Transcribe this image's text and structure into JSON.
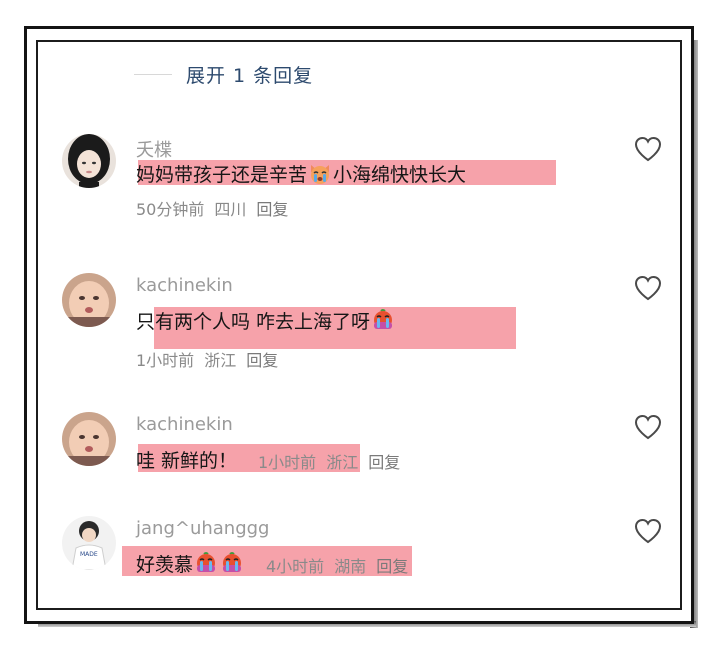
{
  "expand_replies_label": "展开 1 条回复",
  "comments": [
    {
      "username": "夭楪",
      "text_before": "妈妈带孩子还是辛苦",
      "emoji": "crying-cat-emoji",
      "text_after": "小海绵快快长大",
      "time": "50分钟前",
      "location": "四川",
      "reply_label": "回复"
    },
    {
      "username": "kachinekin",
      "text_before": "只有两个人吗 咋去上海了呀",
      "emoji": "crying-face-emoji",
      "text_after": "",
      "time": "1小时前",
      "location": "浙江",
      "reply_label": "回复"
    },
    {
      "username": "kachinekin",
      "text_before": "哇 新鲜的！",
      "emoji": "",
      "text_after": "",
      "time": "1小时前",
      "location": "浙江",
      "reply_label": "回复"
    },
    {
      "username": "jang^uhanggg",
      "text_before": "好羡慕",
      "emoji": "crying-face-emoji x2",
      "text_after": "",
      "time": "4小时前",
      "location": "湖南",
      "reply_label": "回复"
    }
  ],
  "colors": {
    "highlight": "#f48892",
    "expand_text": "#2d4a6e",
    "username": "#9a9a9a",
    "meta": "#8a8a8a"
  }
}
